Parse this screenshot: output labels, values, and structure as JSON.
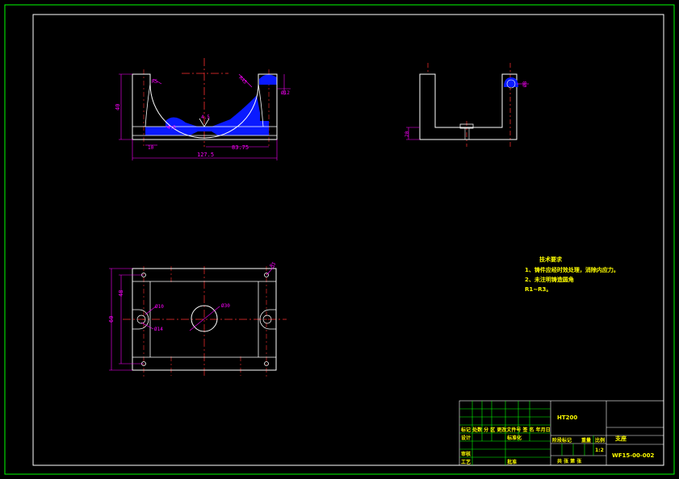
{
  "tech_requirements": {
    "title": "技术要求",
    "line1": "1、铸件应经时效处理，消除内应力。",
    "line2": "2、未注明铸造圆角",
    "line3": "R1~R3。"
  },
  "title_block": {
    "material": "HT200",
    "part_name": "支座",
    "drawing_no": "WF15-00-002",
    "scale": "1:2",
    "sheet": "共 张 第 张",
    "row_headers": "标记 处数 分 区 更改文件号 签 名 年月日",
    "designer": "设计",
    "standardized": "标准化",
    "reviewer": "审核",
    "process": "工艺",
    "approved": "批准",
    "stage_mark": "阶段标记",
    "weight": "重量",
    "scale_label": "比例"
  },
  "dimensions": {
    "front_height": "40",
    "front_width": "127.5",
    "front_span": "83.75",
    "front_r": "R5",
    "front_base": "10",
    "front_boss": "Ø12",
    "front_angle": "4.5",
    "front_center": "4.5",
    "front_radius": "R45",
    "side_height": "20",
    "side_hole": "Ø8",
    "plan_height": "48",
    "plan_depth": "60",
    "plan_r": "R5",
    "plan_hole1": "Ø10",
    "plan_hole2": "Ø30",
    "plan_hole3": "Ø14"
  }
}
